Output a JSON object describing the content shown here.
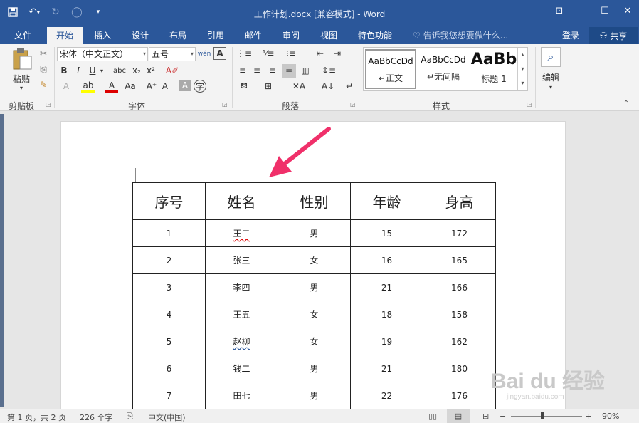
{
  "titlebar": {
    "doc_title": "工作计划.docx [兼容模式] - Word"
  },
  "tabs": [
    {
      "label": "文件"
    },
    {
      "label": "开始"
    },
    {
      "label": "插入"
    },
    {
      "label": "设计"
    },
    {
      "label": "布局"
    },
    {
      "label": "引用"
    },
    {
      "label": "邮件"
    },
    {
      "label": "审阅"
    },
    {
      "label": "视图"
    },
    {
      "label": "特色功能"
    }
  ],
  "tellme": "告诉我您想要做什么...",
  "login": "登录",
  "share": "共享",
  "ribbon": {
    "clipboard": {
      "paste": "粘贴",
      "label": "剪贴板"
    },
    "font": {
      "name": "宋体（中文正文）",
      "size": "五号",
      "label": "字体"
    },
    "paragraph": {
      "label": "段落"
    },
    "styles": {
      "label": "样式",
      "items": [
        {
          "preview": "AaBbCcDd",
          "name": "↵正文"
        },
        {
          "preview": "AaBbCcDd",
          "name": "↵无间隔"
        },
        {
          "preview": "AaBb",
          "name": "标题 1"
        }
      ]
    },
    "editing": {
      "label": "编辑"
    }
  },
  "table": {
    "headers": [
      "序号",
      "姓名",
      "性别",
      "年龄",
      "身高"
    ],
    "rows": [
      [
        "1",
        "王二",
        "男",
        "15",
        "172"
      ],
      [
        "2",
        "张三",
        "女",
        "16",
        "165"
      ],
      [
        "3",
        "李四",
        "男",
        "21",
        "166"
      ],
      [
        "4",
        "王五",
        "女",
        "18",
        "158"
      ],
      [
        "5",
        "赵柳",
        "女",
        "19",
        "162"
      ],
      [
        "6",
        "钱二",
        "男",
        "21",
        "180"
      ],
      [
        "7",
        "田七",
        "男",
        "22",
        "176"
      ]
    ]
  },
  "status": {
    "page": "第 1 页，共 2 页",
    "words": "226 个字",
    "language": "中文(中国)",
    "zoom": "90%"
  },
  "watermark": {
    "main": "Bai du 经验",
    "sub": "jingyan.baidu.com"
  },
  "colors": {
    "brand": "#2b579a",
    "arrow": "#f0306a"
  }
}
